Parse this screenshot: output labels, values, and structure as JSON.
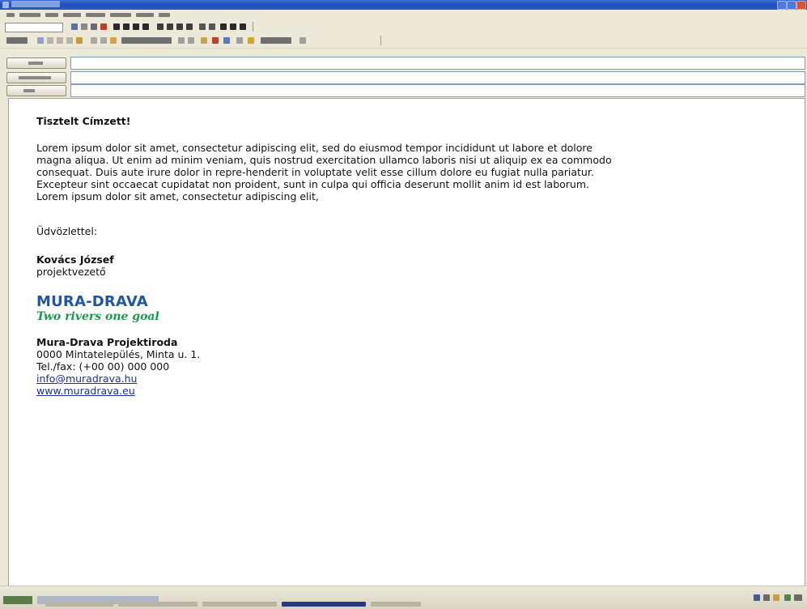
{
  "email": {
    "greeting": "Tisztelt Címzett!",
    "body_paragraphs": [
      "Lorem ipsum dolor sit amet, consectetur adipiscing elit, sed do eiusmod tempor incididunt ut labore et dolore magna aliqua. Ut enim ad minim veniam, quis nostrud exercitation ullamco laboris nisi ut aliquip ex ea commodo consequat. Duis aute irure dolor in repre-henderit in voluptate velit esse cillum dolore eu fugiat nulla pariatur.",
      "Excepteur sint occaecat cupidatat non proident, sunt in culpa qui officia deserunt mollit anim id est laborum. Lorem ipsum dolor sit amet, consectetur adipiscing elit,"
    ],
    "closing": "Üdvözlettel:",
    "sender_name": "Kovács József",
    "sender_title": "projektvezető"
  },
  "signature": {
    "logo_text": "MURA-DRAVA",
    "logo_tagline": "Two rivers one goal",
    "org_name": "Mura-Drava Projektiroda",
    "address": "0000 Mintatelepülés, Minta u. 1.",
    "phone": "Tel./fax: (+00 00) 000 000",
    "email": "info@muradrava.hu",
    "website": "www.muradrava.eu"
  },
  "colors": {
    "logo_blue": "#1f57a8",
    "logo_green": "#1a9a4a",
    "link": "#1b2ea0",
    "titlebar": "#2a5cc4"
  },
  "icons": {
    "titlebar": "app-icon",
    "header_buttons": [
      "to-button",
      "cc-button",
      "subject-button"
    ]
  }
}
